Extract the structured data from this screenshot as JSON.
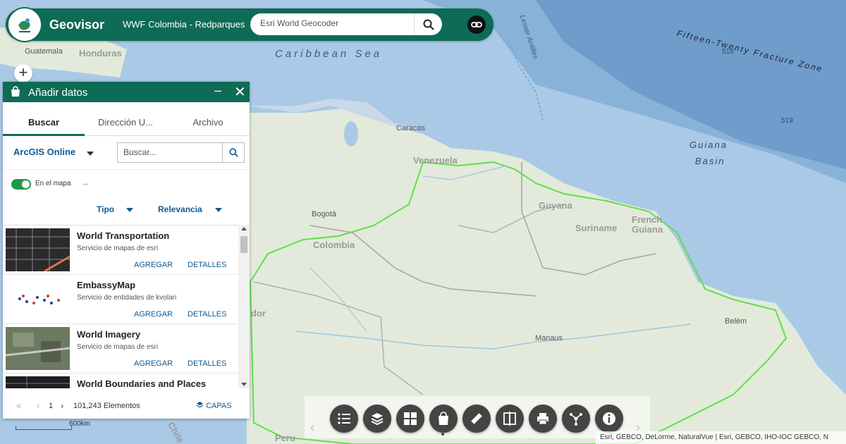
{
  "header": {
    "title": "Geovisor",
    "subtitle": "WWF Colombia - Redparques",
    "search_placeholder": "Esri World Geocoder"
  },
  "map_labels": {
    "caribbean_sea": "Caribbean Sea",
    "guiana_basin_1": "Guiana",
    "guiana_basin_2": "Basin",
    "fracture_zone": "Fifteen-Twenty Fracture Zone",
    "lesser_antilles": "Lesser Antilles",
    "depth_518": "518",
    "depth_519": "519",
    "guatemala": "Guatemala",
    "honduras": "Honduras",
    "venezuela": "Venezuela",
    "caracas": "Caracas",
    "bogota": "Bogotá",
    "colombia": "Colombia",
    "guyana": "Guyana",
    "suriname": "Suriname",
    "french_guiana_1": "French",
    "french_guiana_2": "Guiana",
    "ecuador_partial": "dor",
    "manaus": "Manaus",
    "belem": "Belém",
    "peru": "Peru",
    "chile_partial": "Chile"
  },
  "panel": {
    "title": "Añadir datos",
    "tabs": [
      "Buscar",
      "Dirección U...",
      "Archivo"
    ],
    "source": "ArcGIS Online",
    "search_placeholder": "Buscar...",
    "toggle_label": "En el mapa",
    "toggle_more": "...",
    "filters": [
      "Tipo",
      "Relevancia"
    ],
    "results": [
      {
        "title": "World Transportation",
        "desc": "Servicio de mapas de esri",
        "add": "AGREGAR",
        "details": "DETALLES"
      },
      {
        "title": "EmbassyMap",
        "desc": "Servicio de entidades de kvolari",
        "add": "AGREGAR",
        "details": "DETALLES"
      },
      {
        "title": "World Imagery",
        "desc": "Servicio de mapas de esri",
        "add": "AGREGAR",
        "details": "DETALLES"
      },
      {
        "title": "World Boundaries and Places",
        "desc": "",
        "add": "",
        "details": ""
      }
    ],
    "pagination": {
      "first": "«",
      "prev": "‹",
      "page": "1",
      "next": "›",
      "count": "101,243 Elementos"
    },
    "capas_label": "CAPAS"
  },
  "zoom": {
    "in": "+"
  },
  "toolbar": {
    "buttons": [
      "list-icon",
      "layers-icon",
      "basemap-gallery-icon",
      "add-data-icon",
      "measure-icon",
      "swipe-icon",
      "print-icon",
      "share-icon",
      "info-icon"
    ],
    "prev": "‹",
    "next": "›"
  },
  "attribution": "Esri, GEBCO, DeLorme, NaturalVue | Esri, GEBCO, IHO-IOC GEBCO, N",
  "scale_label": "600km",
  "colors": {
    "brand": "#0e6b55",
    "link": "#0f5a93",
    "toggle_on": "#1f9b47",
    "ocean": "#a9c9e6",
    "land": "#e3eadb",
    "border_highlight": "#5ee04a"
  }
}
